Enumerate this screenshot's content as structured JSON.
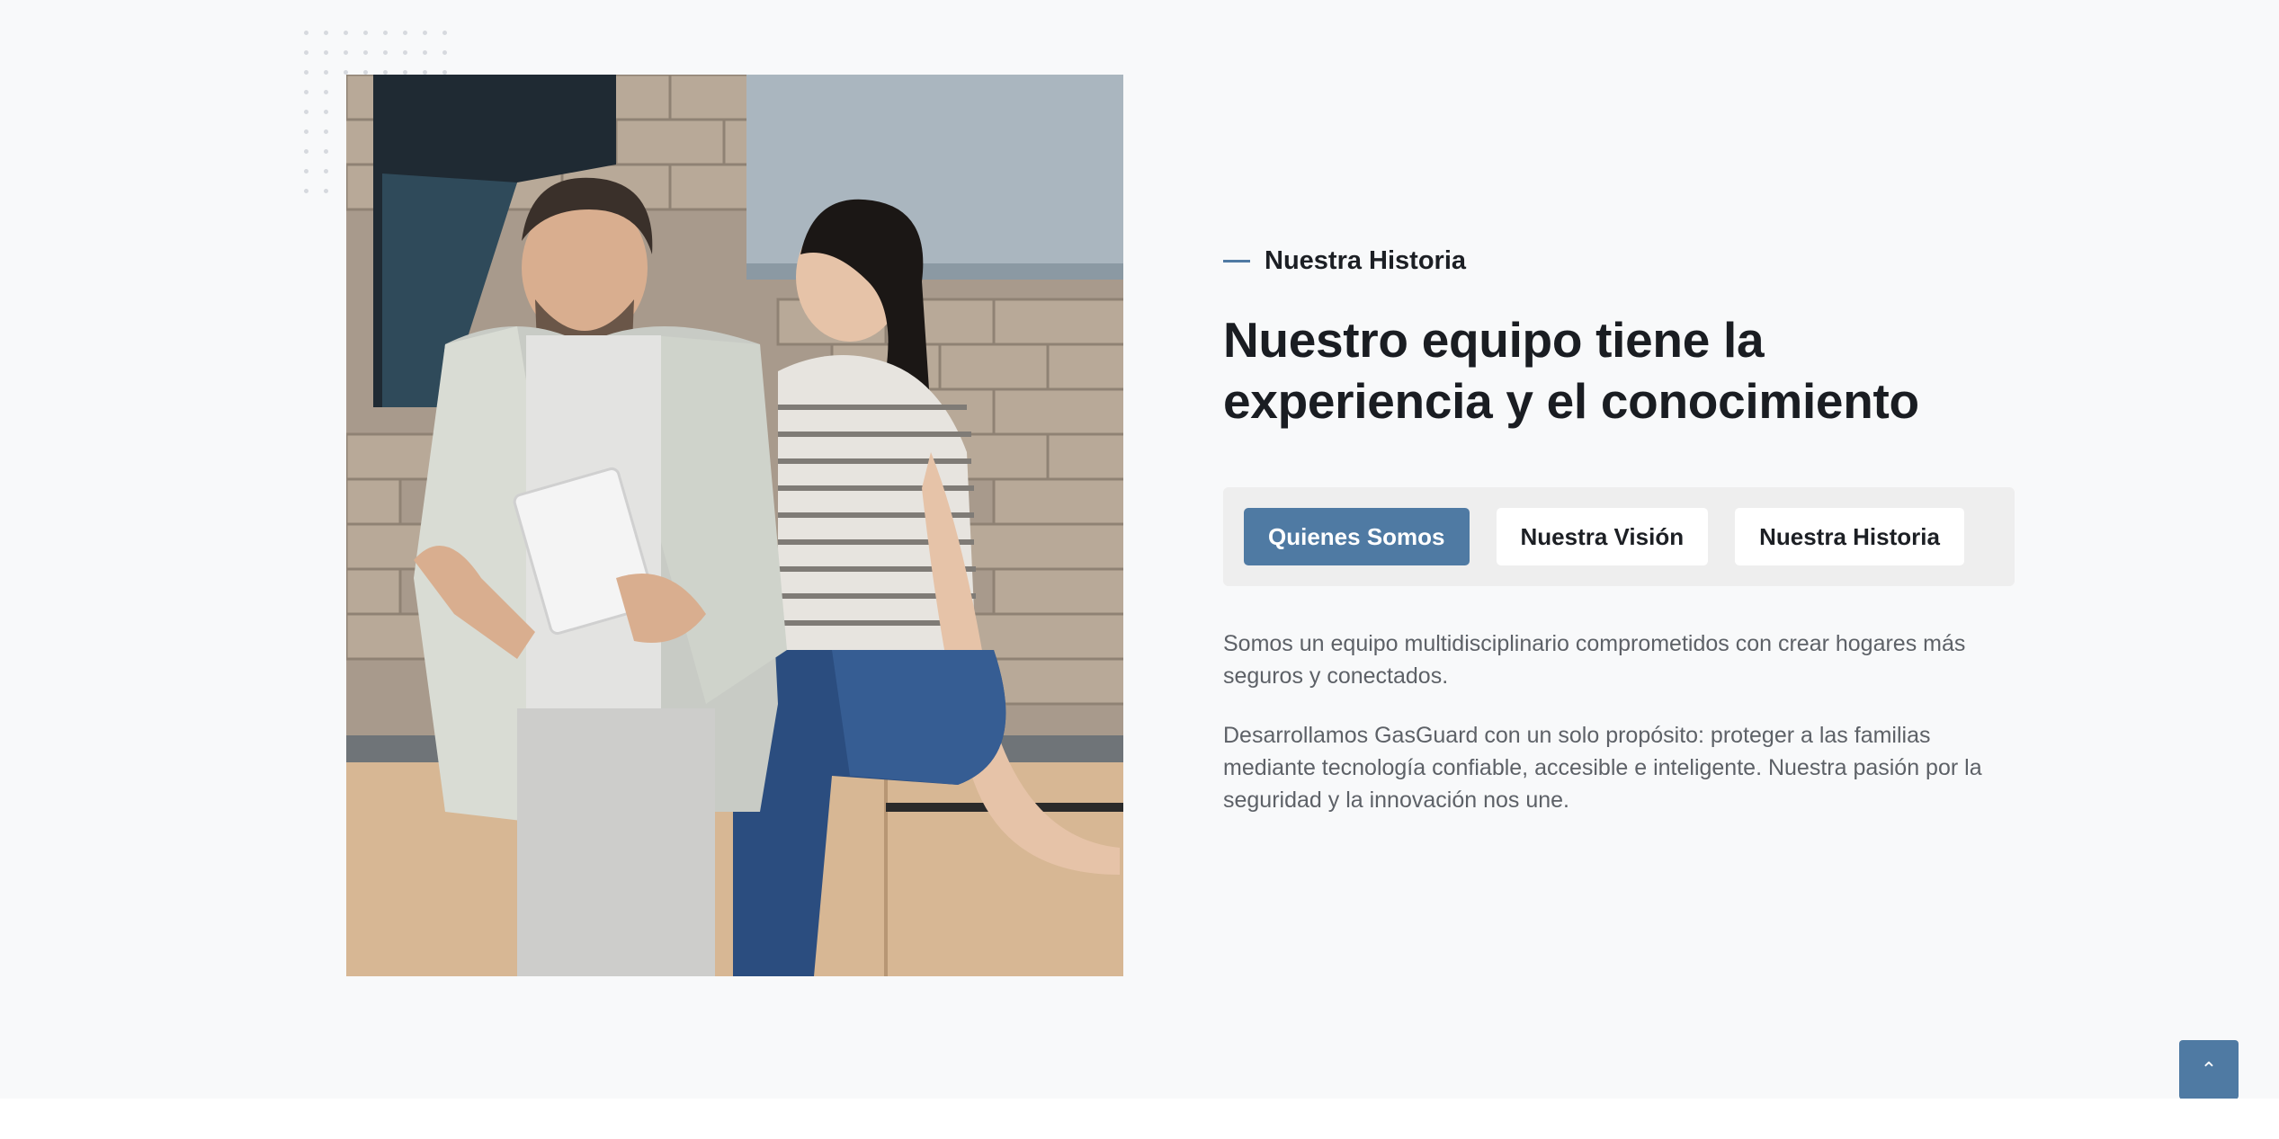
{
  "section": {
    "eyebrow": "Nuestra Historia",
    "headline": "Nuestro equipo tiene la experiencia y el conocimiento"
  },
  "tabs": [
    {
      "label": "Quienes Somos",
      "active": true
    },
    {
      "label": "Nuestra Visión",
      "active": false
    },
    {
      "label": "Nuestra Historia",
      "active": false
    }
  ],
  "tab_content": {
    "paragraph_1": "Somos un equipo multidisciplinario comprometidos con crear hogares más seguros y conectados.",
    "paragraph_2": "Desarrollamos GasGuard con un solo propósito: proteger a las familias mediante tecnología confiable, accesible e inteligente. Nuestra pasión por la seguridad y la innovación nos une."
  },
  "back_to_top": {
    "icon": "chevron-up-icon",
    "glyph": "⌃"
  },
  "colors": {
    "accent": "#4f7aa3",
    "background": "#f8f9fa",
    "heading": "#1a1d22",
    "body_text": "#5d6167"
  }
}
